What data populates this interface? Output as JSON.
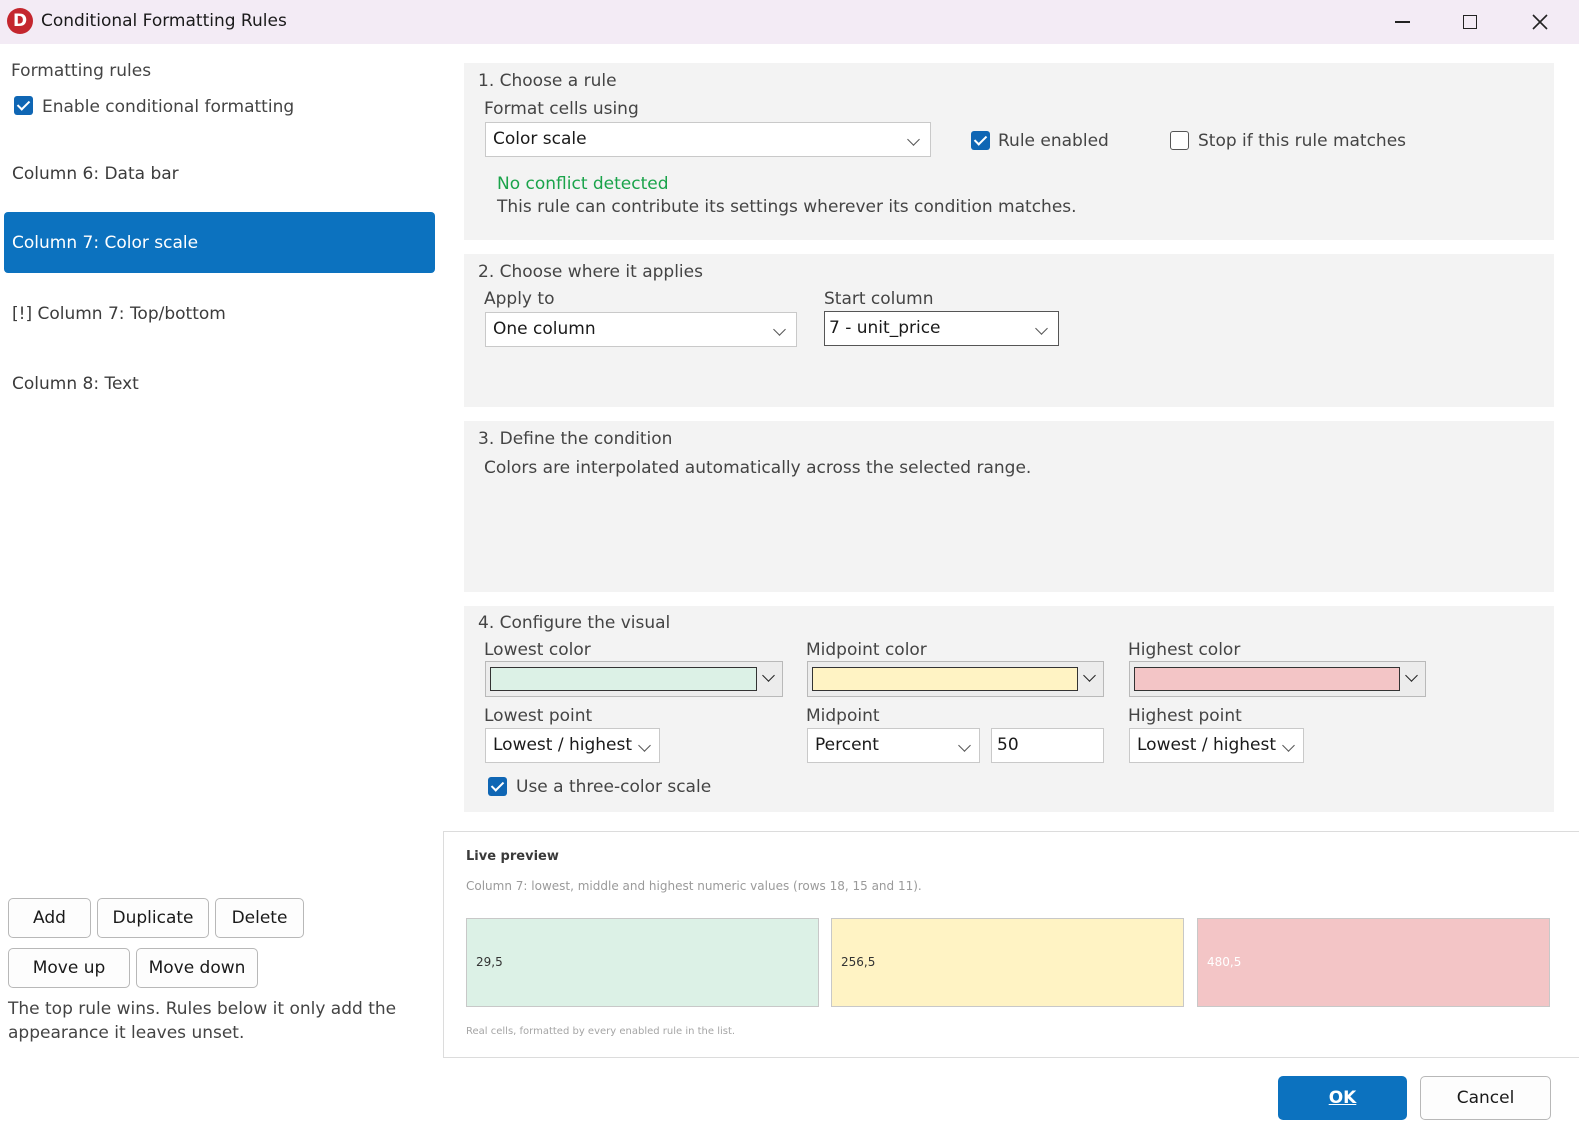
{
  "window": {
    "title": "Conditional Formatting Rules",
    "icon_letter": "D"
  },
  "sidebar": {
    "heading": "Formatting rules",
    "enable_label": "Enable conditional formatting",
    "rules": [
      {
        "label": "Column 6: Data bar"
      },
      {
        "label": "Column 7: Color scale"
      },
      {
        "label": "[!] Column 7: Top/bottom"
      },
      {
        "label": "Column 8: Text"
      }
    ],
    "buttons": {
      "add": "Add",
      "duplicate": "Duplicate",
      "delete": "Delete",
      "move_up": "Move up",
      "move_down": "Move down"
    },
    "note_line1": "The top rule wins. Rules below it only add the",
    "note_line2": "appearance it leaves unset."
  },
  "section1": {
    "title": "1. Choose a rule",
    "format_label": "Format cells using",
    "format_value": "Color scale",
    "rule_enabled": "Rule enabled",
    "stop_label": "Stop if this rule matches",
    "status": "No conflict detected",
    "status_detail": "This rule can contribute its settings wherever its condition matches.",
    "status_color": "#1aa34a"
  },
  "section2": {
    "title": "2. Choose where it applies",
    "apply_label": "Apply to",
    "apply_value": "One column",
    "start_label": "Start column",
    "start_value": "7 - unit_price"
  },
  "section3": {
    "title": "3. Define the condition",
    "text": "Colors are interpolated automatically across the selected range."
  },
  "section4": {
    "title": "4. Configure the visual",
    "lowest_color_label": "Lowest color",
    "lowest_color": "#dcf1e6",
    "mid_color_label": "Midpoint color",
    "mid_color": "#fff3c4",
    "high_color_label": "Highest color",
    "high_color": "#f3c5c6",
    "lowest_point_label": "Lowest point",
    "lowest_point_value": "Lowest / highest",
    "midpoint_label": "Midpoint",
    "midpoint_type": "Percent",
    "midpoint_value": "50",
    "highest_point_label": "Highest point",
    "highest_point_value": "Lowest / highest",
    "three_color_label": "Use a three-color scale"
  },
  "preview": {
    "title": "Live preview",
    "subtitle": "Column 7: lowest, middle and highest numeric values (rows 18, 15 and 11).",
    "cells": [
      {
        "value": "29,5",
        "bg": "#dcf1e6",
        "fg": "#333333"
      },
      {
        "value": "256,5",
        "bg": "#fff3c4",
        "fg": "#333333"
      },
      {
        "value": "480,5",
        "bg": "#f3c5c6",
        "fg": "#ffffff"
      }
    ],
    "footer": "Real cells, formatted by every enabled rule in the list."
  },
  "footer": {
    "ok": "OK",
    "cancel": "Cancel"
  }
}
